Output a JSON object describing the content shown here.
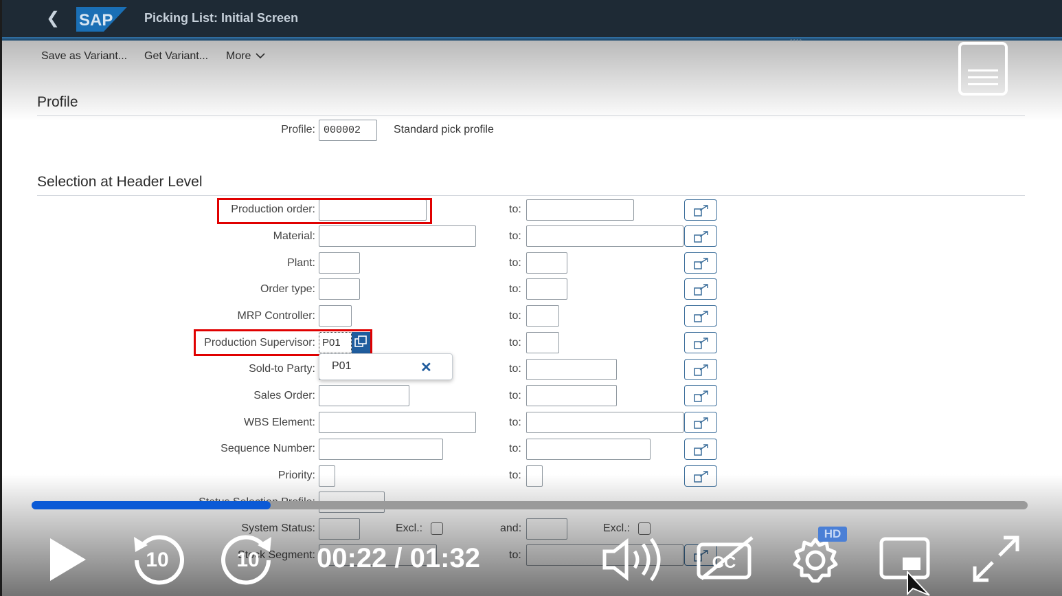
{
  "shell": {
    "back_glyph": "❮",
    "title": "Picking List: Initial Screen",
    "logo_text": "SAP"
  },
  "toolbar": {
    "save_variant": "Save as Variant...",
    "get_variant": "Get Variant...",
    "more": "More"
  },
  "profile_section": {
    "title": "Profile",
    "label": "Profile:",
    "value": "000002",
    "description": "Standard pick profile"
  },
  "header_section": {
    "title": "Selection at Header Level",
    "to_label": "to:",
    "and_label": "and:",
    "excl_label": "Excl.:",
    "rows": [
      {
        "label": "Production order:",
        "value": ""
      },
      {
        "label": "Material:",
        "value": ""
      },
      {
        "label": "Plant:",
        "value": ""
      },
      {
        "label": "Order type:",
        "value": ""
      },
      {
        "label": "MRP Controller:",
        "value": ""
      },
      {
        "label": "Production Supervisor:",
        "value": "P01"
      },
      {
        "label": "Sold-to Party:",
        "value": ""
      },
      {
        "label": "Sales Order:",
        "value": ""
      },
      {
        "label": "WBS Element:",
        "value": ""
      },
      {
        "label": "Sequence Number:",
        "value": ""
      },
      {
        "label": "Priority:",
        "value": ""
      },
      {
        "label": "Status Selection Profile:",
        "value": ""
      },
      {
        "label": "System Status:",
        "value": ""
      },
      {
        "label": "Stock Segment:",
        "value": ""
      }
    ]
  },
  "suggestion": {
    "value": "P01",
    "close_glyph": "✕"
  },
  "video": {
    "time": "00:22 / 01:32",
    "progress_fraction": 0.24,
    "skip_seconds": "10",
    "quality_badge": "HD",
    "accent": "#0b5ad6"
  },
  "colors": {
    "shell_bg": "#1e2a35",
    "highlight": "#e00000",
    "button_border": "#3a6d9a"
  }
}
